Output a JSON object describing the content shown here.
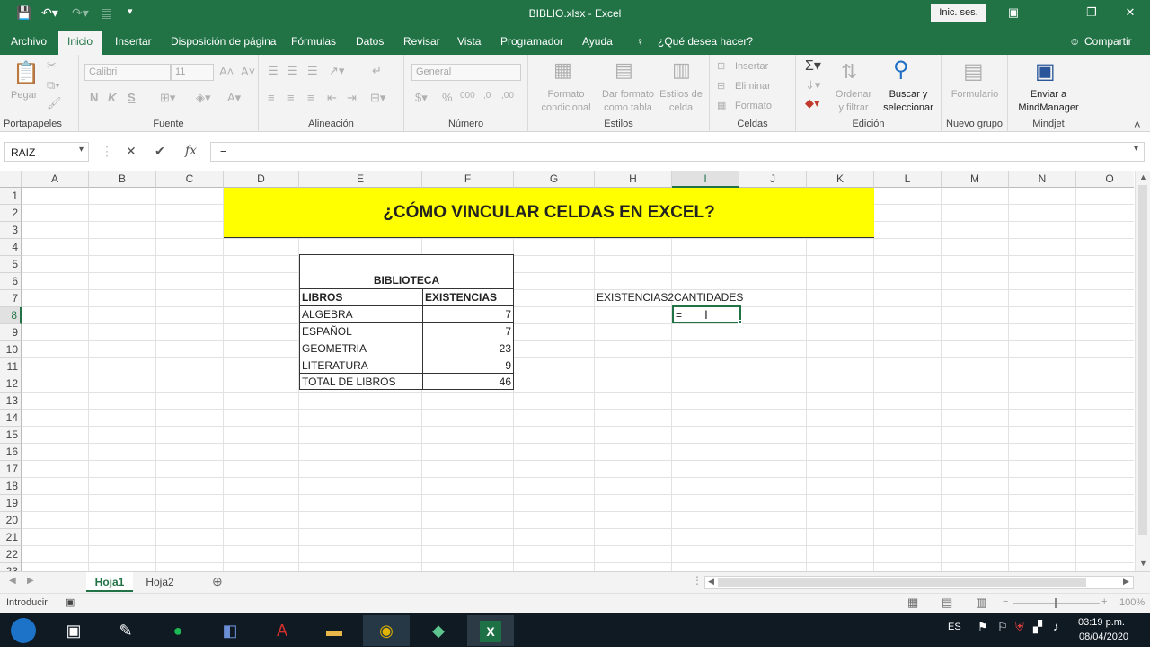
{
  "window": {
    "title": "BIBLIO.xlsx  -  Excel",
    "signin": "Inic. ses."
  },
  "tabs": [
    "Archivo",
    "Inicio",
    "Insertar",
    "Disposición de página",
    "Fórmulas",
    "Datos",
    "Revisar",
    "Vista",
    "Programador",
    "Ayuda"
  ],
  "tell_me": "¿Qué desea hacer?",
  "share": "Compartir",
  "ribbon": {
    "portapapeles": {
      "label": "Portapapeles",
      "paste": "Pegar"
    },
    "fuente": {
      "label": "Fuente",
      "font": "Calibri",
      "size": "11",
      "bold": "N",
      "italic": "K",
      "underline": "S"
    },
    "alineacion": {
      "label": "Alineación"
    },
    "numero": {
      "label": "Número",
      "format": "General"
    },
    "estilos": {
      "label": "Estilos",
      "cond1": "Formato",
      "cond2": "condicional",
      "table1": "Dar formato",
      "table2": "como tabla",
      "cell1": "Estilos de",
      "cell2": "celda"
    },
    "celdas": {
      "label": "Celdas",
      "insert": "Insertar",
      "delete": "Eliminar",
      "format": "Formato"
    },
    "edicion": {
      "label": "Edición",
      "sort1": "Ordenar",
      "sort2": "y filtrar",
      "find1": "Buscar y",
      "find2": "seleccionar"
    },
    "nuevo": {
      "label": "Nuevo grupo",
      "form": "Formulario"
    },
    "mindjet": {
      "label": "Mindjet",
      "send1": "Enviar a",
      "send2": "MindManager"
    }
  },
  "formula": {
    "namebox": "RAIZ",
    "content": "="
  },
  "columns": [
    "A",
    "B",
    "C",
    "D",
    "E",
    "F",
    "G",
    "H",
    "I",
    "J",
    "K",
    "L",
    "M",
    "N",
    "O"
  ],
  "rows": [
    "1",
    "2",
    "3",
    "4",
    "5",
    "6",
    "7",
    "8",
    "9",
    "10",
    "11",
    "12",
    "13",
    "14",
    "15",
    "16",
    "17",
    "18",
    "19",
    "20",
    "21",
    "22",
    "23"
  ],
  "sheet": {
    "banner": "¿CÓMO VINCULAR CELDAS EN EXCEL?",
    "table_title": "BIBLIOTECA",
    "headers": [
      "LIBROS",
      "EXISTENCIAS"
    ],
    "rows": [
      {
        "book": "ALGEBRA",
        "qty": "7"
      },
      {
        "book": "ESPAÑOL",
        "qty": "7"
      },
      {
        "book": "GEOMETRIA",
        "qty": "23"
      },
      {
        "book": "LITERATURA",
        "qty": "9"
      },
      {
        "book": "TOTAL DE LIBROS",
        "qty": "46"
      }
    ],
    "h7": "EXISTENCIAS2",
    "i7": "CANTIDADES",
    "i8": "="
  },
  "sheet_tabs": [
    "Hoja1",
    "Hoja2"
  ],
  "status": {
    "mode": "Introducir",
    "zoom": "100%"
  },
  "tray": {
    "lang": "ES",
    "time": "03:19 p.m.",
    "date": "08/04/2020"
  }
}
